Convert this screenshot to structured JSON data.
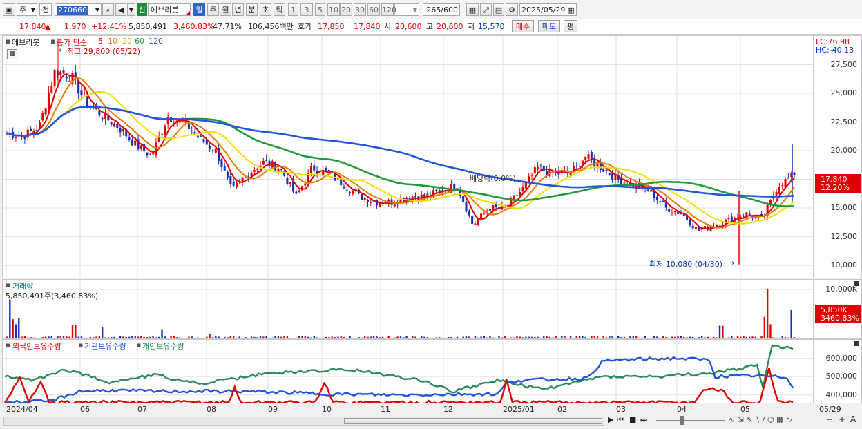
{
  "toolbar": {
    "period_type": "주",
    "scope": "전",
    "code": "270660",
    "badge": "신",
    "name": "에브리봇",
    "intervals": [
      "일",
      "주",
      "월",
      "년",
      "분",
      "초",
      "틱"
    ],
    "active_interval": "일",
    "minutes": [
      "1",
      "3",
      "5",
      "10",
      "20",
      "30",
      "60",
      "120"
    ],
    "count": "265",
    "count_max": "/600",
    "date": "2025/05/29"
  },
  "quote": {
    "price": "17,840",
    "change": "1,970",
    "change_pct": "+12.41%",
    "volume": "5,850,491",
    "volume_pct": "3,460.83%",
    "ratio": "47.71%",
    "amount": "106,456백만",
    "hoga_label": "호가",
    "ask": "17,850",
    "bid": "17,840",
    "open_label": "시",
    "open": "20,600",
    "high_label": "고",
    "high": "20,600",
    "low_label": "저",
    "low": "15,570",
    "buy": "매수",
    "sell": "매도",
    "eval": "평"
  },
  "price_panel": {
    "stock_name": "에브리봇",
    "ma_label": "종가 단순",
    "ma_periods": [
      "5",
      "10",
      "20",
      "60",
      "120"
    ],
    "ma_colors": [
      "#e00000",
      "#e87a00",
      "#f0e000",
      "#1e9a3c",
      "#2255dd"
    ],
    "high_marker": "최고 29,800 (05/22)",
    "low_marker": "최저 10,080 (04/30)",
    "dividend_label": "배당락(0.0%)",
    "lc": "LC:76.98",
    "hc": "HC:-40.13",
    "current_price_tag": "17,840",
    "current_change_tag": "12.20%"
  },
  "volume_panel": {
    "title": "거래량",
    "value": "5,850,491주(3,460.83%)",
    "tag_value": "5,850K",
    "tag_pct": "3460.83%"
  },
  "holding_panel": {
    "series": [
      "외국인보유수량",
      "기관보유수량",
      "개인보유수량"
    ],
    "colors": [
      "#e00000",
      "#2255dd",
      "#2a8a5a"
    ]
  },
  "x_axis": [
    "2024/04",
    "06",
    "07",
    "08",
    "09",
    "10",
    "11",
    "12",
    "2025/01",
    "02",
    "03",
    "04",
    "05"
  ],
  "x_right_label": "05/29",
  "chart_data": [
    {
      "type": "candlestick",
      "title": "에브리봇",
      "ylim": [
        8800,
        30000
      ],
      "yticks": [
        "27,500",
        "25,000",
        "22,500",
        "20,000",
        "17,500",
        "15,000",
        "12,500",
        "10,000"
      ],
      "ytick_values": [
        27500,
        25000,
        22500,
        20000,
        17500,
        15000,
        12500,
        10000
      ],
      "close_trend": [
        21500,
        21300,
        22000,
        27000,
        26500,
        24000,
        23000,
        22000,
        20500,
        19500,
        23000,
        22500,
        21000,
        20000,
        16500,
        18000,
        19000,
        18500,
        16000,
        18500,
        18000,
        17000,
        16000,
        15500,
        15500,
        16000,
        16000,
        16500,
        17000,
        13500,
        15000,
        15000,
        16500,
        18500,
        18000,
        18000,
        19500,
        18500,
        17500,
        17000,
        16500,
        15000,
        14500,
        13000,
        13500,
        14000,
        14500,
        14000,
        17000,
        17840
      ]
    },
    {
      "type": "bar",
      "title": "거래량",
      "ylim": [
        0,
        10000
      ],
      "yticks": [
        "10,000K"
      ],
      "ytick_values": [
        10000
      ]
    },
    {
      "type": "line",
      "title": "외국인보유수량 / 기관보유수량 / 개인보유수량",
      "ylim": [
        350000,
        700000
      ],
      "yticks": [
        "600,000",
        "500,000",
        "400,000"
      ],
      "ytick_values": [
        600000,
        500000,
        400000
      ]
    }
  ]
}
